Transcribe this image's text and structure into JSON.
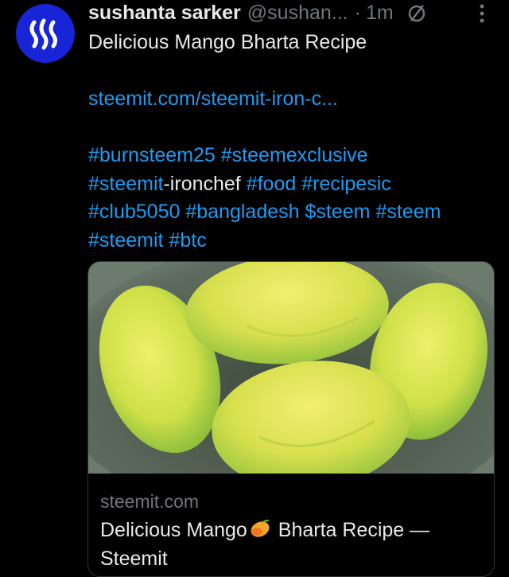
{
  "author": {
    "name": "sushanta sarker",
    "handle": "@sushan...",
    "separator": "·",
    "time": "1m"
  },
  "post": {
    "title": "Delicious Mango Bharta Recipe",
    "link": "steemit.com/steemit-iron-c...",
    "hashtags_line1": [
      "#burnsteem25",
      "#steemexclusive"
    ],
    "hashtags_line2_link": "#steemit",
    "hashtags_line2_plain": "-ironchef",
    "hashtags_line2_rest": [
      "#food",
      "#recipesic"
    ],
    "hashtags_line3": [
      "#club5050",
      "#bangladesh",
      "$steem",
      "#steem"
    ],
    "hashtags_line4": [
      "#steemit",
      "#btc"
    ]
  },
  "card": {
    "domain": "steemit.com",
    "title_part1": "Delicious Mango",
    "title_part2": " Bharta Recipe —",
    "title_line2": "Steemit"
  },
  "colors": {
    "background": "#000000",
    "link": "#1d9bf0",
    "avatar": "#1725d6",
    "muted": "#71767b"
  },
  "icons": [
    "steem-logo-icon",
    "no-circle-icon",
    "more-options-icon",
    "mango-emoji-icon"
  ]
}
